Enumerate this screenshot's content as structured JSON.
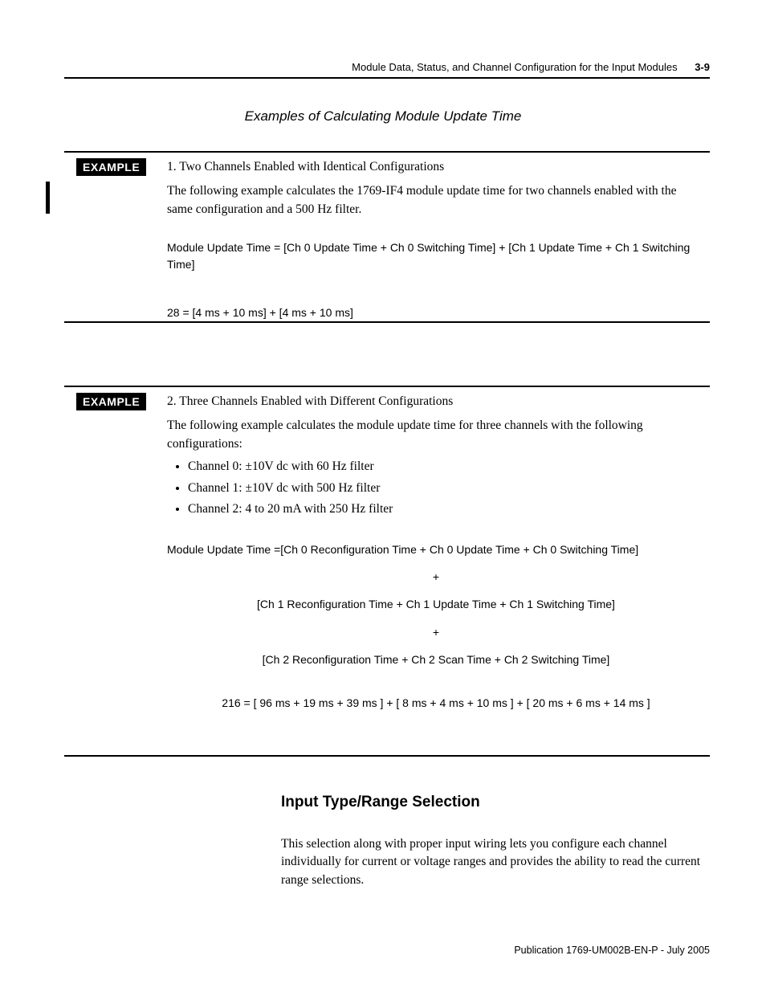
{
  "header": {
    "running_title": "Module Data, Status, and Channel Configuration for the Input Modules",
    "page_number": "3-9"
  },
  "subhead": "Examples of Calculating Module Update Time",
  "example1": {
    "label": "EXAMPLE",
    "title": "1. Two Channels Enabled with Identical Configurations",
    "intro": "The following example calculates the 1769-IF4 module update time for two channels enabled with the same configuration and a 500 Hz filter.",
    "formula": "Module Update Time = [Ch 0 Update Time + Ch 0 Switching Time] + [Ch 1 Update Time + Ch 1 Switching Time]",
    "result": "28 = [4 ms + 10 ms] + [4 ms + 10 ms]"
  },
  "example2": {
    "label": "EXAMPLE",
    "title": "2. Three Channels Enabled with Different Configurations",
    "intro": "The following example calculates the module update time for three channels with the following configurations:",
    "bullets": [
      "Channel 0: ±10V dc with 60 Hz filter",
      "Channel 1: ±10V dc with 500 Hz filter",
      "Channel 2: 4 to 20 mA with 250 Hz filter"
    ],
    "formula_l1": "Module Update Time =[Ch 0 Reconfiguration Time + Ch 0 Update Time + Ch 0 Switching Time]",
    "plus": "+",
    "formula_l2": "[Ch 1 Reconfiguration Time + Ch 1 Update Time + Ch 1 Switching Time]",
    "formula_l3": "[Ch 2 Reconfiguration Time + Ch 2 Scan Time + Ch 2 Switching Time]",
    "result": "216  =  [ 96 ms + 19 ms + 39 ms ] + [ 8 ms + 4 ms + 10 ms ] + [ 20 ms + 6 ms + 14 ms ]"
  },
  "section": {
    "heading": "Input Type/Range Selection",
    "body": "This selection along with proper input wiring lets you configure each channel individually for current or voltage ranges and provides the ability to read the current range selections."
  },
  "footer": "Publication 1769-UM002B-EN-P - July 2005"
}
